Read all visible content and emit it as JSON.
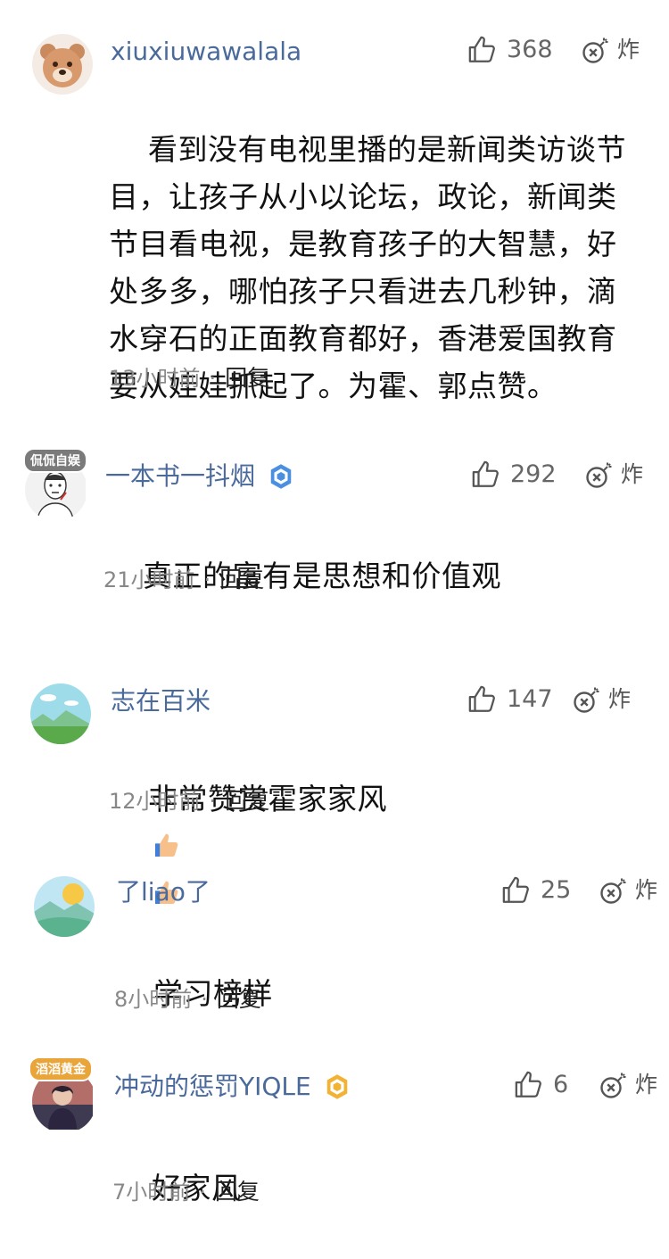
{
  "comments": [
    {
      "username": "xiuxiuwawalala",
      "likes": "368",
      "bomb_label": "炸",
      "text": "看到没有电视里播的是新闻类访谈节目，让孩子从小以论坛，政论，新闻类节目看电视，是教育孩子的大智慧，好处多多，哪怕孩子只看进去几秒钟，滴水穿石的正面教育都好，香港爱国教育要从娃娃抓起了。为霍、郭点赞。",
      "time": "13小时前",
      "reply": "回复"
    },
    {
      "username": "一本书一抖烟",
      "avatar_tag": "侃侃自娱",
      "likes": "292",
      "bomb_label": "炸",
      "text": "真正的富有是思想和价值观",
      "time": "21小时前",
      "reply": "回复"
    },
    {
      "username": "志在百米",
      "likes": "147",
      "bomb_label": "炸",
      "text": "非常赞赏霍家家风",
      "time": "12小时前",
      "reply": "回复"
    },
    {
      "username": "了liao了",
      "likes": "25",
      "bomb_label": "炸",
      "text": "学习榜样",
      "time": "8小时前",
      "reply": "回复"
    },
    {
      "username": "冲动的惩罚YIQLE",
      "avatar_tag": "滔滔黄金",
      "likes": "6",
      "bomb_label": "炸",
      "text": "好家风",
      "time": "7小时前",
      "reply": "回复"
    }
  ],
  "separator": "·",
  "colors": {
    "username": "#4a6a9c",
    "badge_blue": "#4a8fe0",
    "badge_gold": "#f2b233"
  },
  "icons": {
    "like": "thumbs-up-icon",
    "bomb": "bomb-icon",
    "emoji": "thumbs-up-emoji"
  }
}
